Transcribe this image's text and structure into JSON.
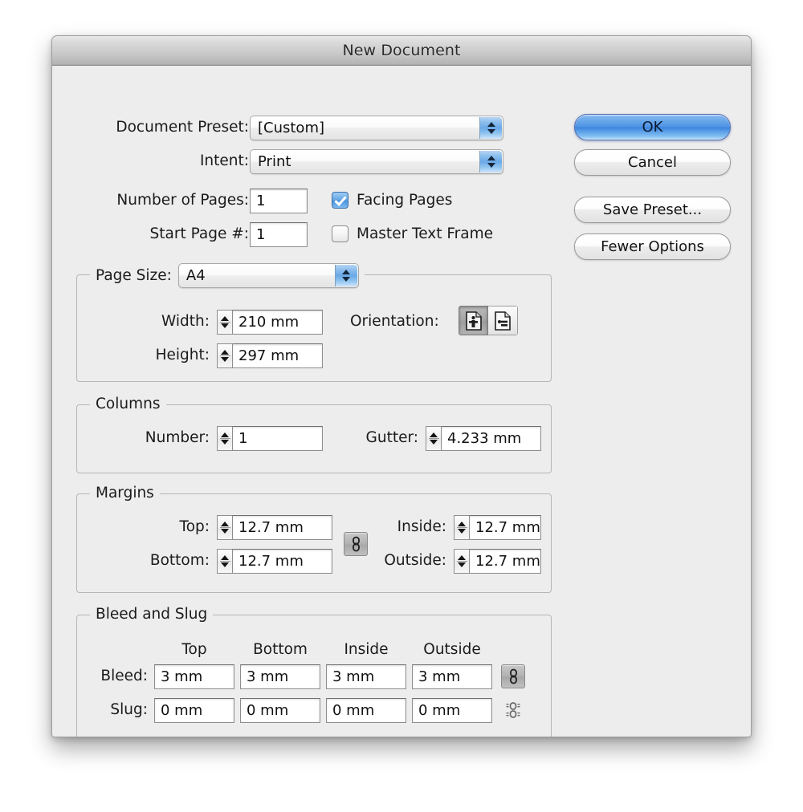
{
  "window": {
    "title": "New Document"
  },
  "form": {
    "document_preset": {
      "label": "Document Preset:",
      "value": "[Custom]"
    },
    "intent": {
      "label": "Intent:",
      "value": "Print"
    },
    "number_of_pages": {
      "label": "Number of Pages:",
      "value": "1"
    },
    "start_page": {
      "label": "Start Page #:",
      "value": "1"
    },
    "facing_pages": {
      "label": "Facing Pages",
      "checked": true
    },
    "master_text_frame": {
      "label": "Master Text Frame",
      "checked": false
    }
  },
  "page_size": {
    "group_label": "Page Size:",
    "preset": "A4",
    "width": {
      "label": "Width:",
      "value": "210 mm"
    },
    "height": {
      "label": "Height:",
      "value": "297 mm"
    },
    "orientation": {
      "label": "Orientation:",
      "portrait_icon": "portrait-page-icon",
      "landscape_icon": "landscape-page-icon",
      "selected": "portrait"
    }
  },
  "columns": {
    "group_label": "Columns",
    "number": {
      "label": "Number:",
      "value": "1"
    },
    "gutter": {
      "label": "Gutter:",
      "value": "4.233 mm"
    }
  },
  "margins": {
    "group_label": "Margins",
    "top": {
      "label": "Top:",
      "value": "12.7 mm"
    },
    "bottom": {
      "label": "Bottom:",
      "value": "12.7 mm"
    },
    "inside": {
      "label": "Inside:",
      "value": "12.7 mm"
    },
    "outside": {
      "label": "Outside:",
      "value": "12.7 mm"
    },
    "link_icon": "chain-link-icon"
  },
  "bleed_and_slug": {
    "group_label": "Bleed and Slug",
    "column_headers": [
      "Top",
      "Bottom",
      "Inside",
      "Outside"
    ],
    "bleed": {
      "label": "Bleed:",
      "values": [
        "3 mm",
        "3 mm",
        "3 mm",
        "3 mm"
      ],
      "link_icon": "chain-link-icon"
    },
    "slug": {
      "label": "Slug:",
      "values": [
        "0 mm",
        "0 mm",
        "0 mm",
        "0 mm"
      ],
      "link_icon": "chain-link-broken-icon"
    }
  },
  "buttons": {
    "ok": "OK",
    "cancel": "Cancel",
    "save_preset": "Save Preset...",
    "fewer_options": "Fewer Options"
  },
  "colors": {
    "dialog_bg": "#ededed",
    "accent_blue": "#4f93e4",
    "popup_arrow_blue": "#6aa9e6",
    "field_bg": "#ffffff",
    "text": "#1b1b1b"
  }
}
